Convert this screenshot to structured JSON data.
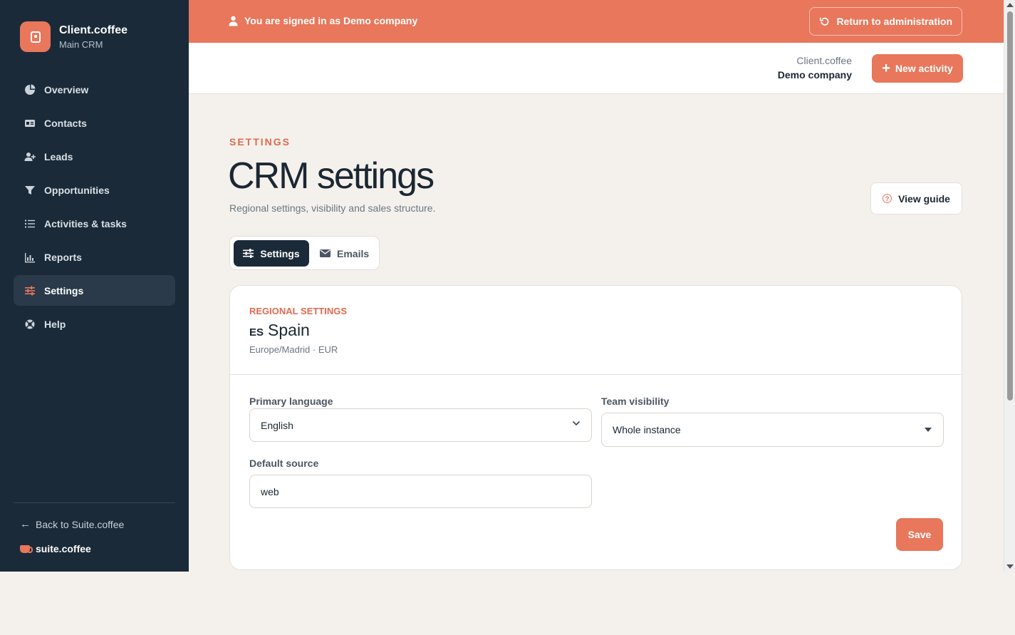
{
  "brand": {
    "name": "Client.coffee",
    "subtitle": "Main CRM"
  },
  "nav": {
    "items": [
      {
        "label": "Overview",
        "icon": "pie-chart-icon"
      },
      {
        "label": "Contacts",
        "icon": "id-card-icon"
      },
      {
        "label": "Leads",
        "icon": "user-plus-icon"
      },
      {
        "label": "Opportunities",
        "icon": "funnel-icon"
      },
      {
        "label": "Activities & tasks",
        "icon": "list-icon"
      },
      {
        "label": "Reports",
        "icon": "bar-chart-icon"
      },
      {
        "label": "Settings",
        "icon": "sliders-icon",
        "active": true
      },
      {
        "label": "Help",
        "icon": "lifebuoy-icon"
      }
    ],
    "back_label": "Back to Suite.coffee",
    "suite_label": "suite.coffee"
  },
  "banner": {
    "text": "You are signed in as Demo company",
    "return_label": "Return to administration"
  },
  "header": {
    "org": "Client.coffee",
    "company": "Demo company",
    "new_activity_label": "New activity"
  },
  "page": {
    "eyebrow": "SETTINGS",
    "title": "CRM settings",
    "subtitle": "Regional settings, visibility and sales structure.",
    "view_guide_label": "View guide"
  },
  "tabs": [
    {
      "label": "Settings",
      "active": true
    },
    {
      "label": "Emails",
      "active": false
    }
  ],
  "regional": {
    "section_label": "REGIONAL SETTINGS",
    "country_code": "ES",
    "country": "Spain",
    "meta": "Europe/Madrid · EUR"
  },
  "form": {
    "primary_language": {
      "label": "Primary language",
      "value": "English"
    },
    "team_visibility": {
      "label": "Team visibility",
      "value": "Whole instance"
    },
    "default_source": {
      "label": "Default source",
      "value": "web"
    },
    "save_label": "Save"
  },
  "colors": {
    "accent": "#e8775b",
    "sidebar": "#1b2a38",
    "background": "#f4f1ec"
  }
}
